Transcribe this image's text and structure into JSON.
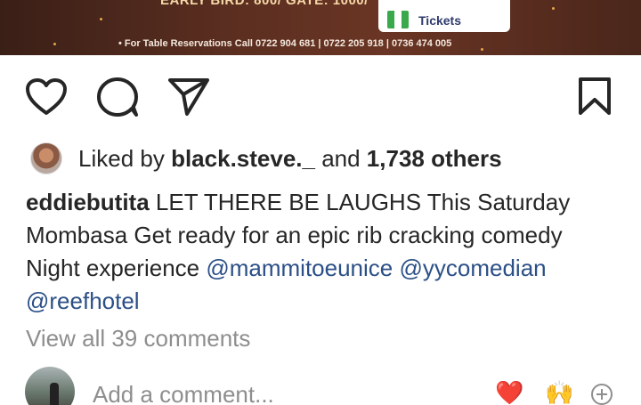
{
  "poster": {
    "headline": "EARLY BIRD: 800/   GATE: 1000/",
    "tickets_label": "Tickets",
    "reservations": "• For Table Reservations Call 0722 904 681 | 0722 205 918 | 0736 474 005"
  },
  "actions": {
    "like_icon": "heart-outline-icon",
    "comment_icon": "comment-bubble-icon",
    "share_icon": "paper-plane-icon",
    "save_icon": "bookmark-icon"
  },
  "likes": {
    "prefix": "Liked by ",
    "user": "black.steve._",
    "middle": " and ",
    "count": "1,738 others"
  },
  "caption": {
    "username": "eddiebutita",
    "text": " LET THERE BE LAUGHS This Saturday Mombasa Get ready for an epic rib cracking comedy Night  experience ",
    "mentions": [
      "@mammitoeunice",
      "@yycomedian",
      "@reefhotel"
    ]
  },
  "view_all_comments": "View all 39 comments",
  "comment_bar": {
    "placeholder": "Add a comment...",
    "emoji_heart": "❤️",
    "emoji_hands": "🙌",
    "add_icon": "plus-circle-icon"
  },
  "colors": {
    "mention": "#2b4f86",
    "muted": "#8e8e8e",
    "text": "#262626",
    "heart": "#d8132e"
  }
}
